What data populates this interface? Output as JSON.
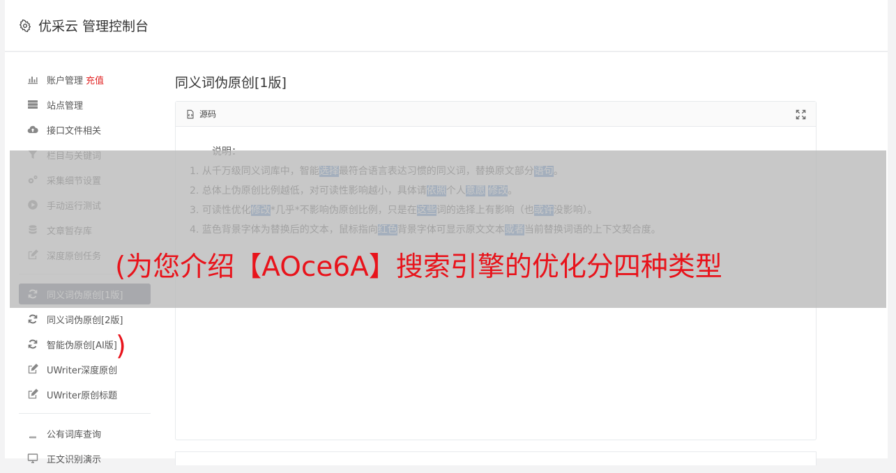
{
  "header": {
    "title": "优采云 管理控制台"
  },
  "sidebar": {
    "group1": [
      {
        "label": "账户管理",
        "badge": "充值",
        "icon": "bar-chart-icon"
      },
      {
        "label": "站点管理",
        "icon": "server-icon"
      },
      {
        "label": "接口文件相关",
        "icon": "cloud-upload-icon"
      },
      {
        "label": "栏目与关键词",
        "icon": "filter-icon"
      },
      {
        "label": "采集细节设置",
        "icon": "gears-icon"
      },
      {
        "label": "手动运行测试",
        "icon": "play-circle-icon"
      },
      {
        "label": "文章暂存库",
        "icon": "database-icon"
      },
      {
        "label": "深度原创任务",
        "icon": "edit-icon"
      }
    ],
    "group2": [
      {
        "label": "同义词伪原创[1版]",
        "icon": "refresh-icon",
        "active": true
      },
      {
        "label": "同义词伪原创[2版]",
        "icon": "refresh-icon"
      },
      {
        "label": "智能伪原创[AI版]",
        "icon": "refresh-icon"
      },
      {
        "label": "UWriter深度原创",
        "icon": "edit-icon"
      },
      {
        "label": "UWriter原创标题",
        "icon": "edit-icon"
      }
    ],
    "group3": [
      {
        "label": "公有词库查询",
        "icon": "book-icon"
      },
      {
        "label": "正文识别演示",
        "icon": "monitor-icon"
      }
    ]
  },
  "main": {
    "page_title": "同义词伪原创[1版]",
    "panel_title": "源码",
    "desc": {
      "lead": "说明：",
      "items": [
        {
          "parts": [
            [
              "1. 从千万级同义词库中，智能",
              false
            ],
            [
              "选择",
              true
            ],
            [
              "最符合语言表达习惯的同义词，替换原文部分",
              false
            ],
            [
              "语句",
              true
            ],
            [
              "。",
              false
            ]
          ]
        },
        {
          "parts": [
            [
              "2. 总体上伪原创比例越低，对可读性影响越小，具体请",
              false
            ],
            [
              "依照",
              true
            ],
            [
              "个人",
              false
            ],
            [
              "意愿",
              true
            ],
            [
              " ",
              false
            ],
            [
              "修改",
              true
            ],
            [
              "。",
              false
            ]
          ]
        },
        {
          "parts": [
            [
              "3. 可读性优化",
              false
            ],
            [
              "修改",
              true
            ],
            [
              "*几乎*不影响伪原创比例，只是在",
              false
            ],
            [
              "这些",
              true
            ],
            [
              "词的选择上有影响（也",
              false
            ],
            [
              "或许",
              true
            ],
            [
              "没影响）。",
              false
            ]
          ]
        },
        {
          "parts": [
            [
              "4. 蓝色背景字体为替换后的文本，鼠标指向",
              false
            ],
            [
              "红色",
              true
            ],
            [
              "背景字体可显示原文文本",
              false
            ],
            [
              "或者",
              true
            ],
            [
              "当前替换词语的上下文契合度。",
              false
            ]
          ]
        }
      ]
    }
  },
  "overlay": {
    "text": "(为您介绍【AOce6A】搜索引擎的优化分四种类型",
    "paren": ")"
  },
  "colors": {
    "active_nav_bg": "#6c7483",
    "highlight_bg": "#5b8fce",
    "overlay_text": "#e8131b",
    "badge_red": "#e12323"
  }
}
